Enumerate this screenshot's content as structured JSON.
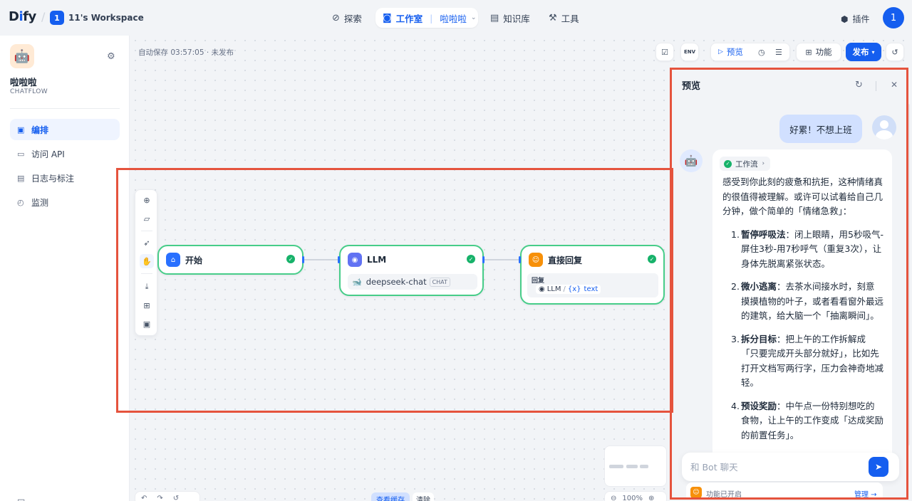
{
  "topbar": {
    "logo": "Dify",
    "workspace_badge": "1",
    "workspace_name": "11's Workspace",
    "nav": {
      "explore": "探索",
      "studio": "工作室",
      "app": "啦啦啦",
      "knowledge": "知识库",
      "tools": "工具"
    },
    "plugins": "插件",
    "user_initial": "1"
  },
  "sidebar": {
    "app_name": "啦啦啦",
    "app_type": "CHATFLOW",
    "items": [
      {
        "label": "编排",
        "active": true
      },
      {
        "label": "访问 API",
        "active": false
      },
      {
        "label": "日志与标注",
        "active": false
      },
      {
        "label": "监测",
        "active": false
      }
    ]
  },
  "canvas": {
    "autosave": "自动保存 03:57:05 · 未发布",
    "toolbar": {
      "env": "ENV",
      "preview": "预览",
      "features": "功能",
      "publish": "发布"
    },
    "nodes": {
      "start": {
        "title": "开始"
      },
      "llm": {
        "title": "LLM",
        "model": "deepseek-chat",
        "mode_badge": "CHAT"
      },
      "answer": {
        "title": "直接回复",
        "label": "回复",
        "var_node": "LLM",
        "var_name": "text",
        "var_prefix": "{x}"
      }
    },
    "bottom": {
      "view_cache": "查看缓存",
      "clear": "清除",
      "zoom": "100%"
    }
  },
  "preview": {
    "title": "预览",
    "user_message": "好累！不想上班",
    "workflow_chip": "工作流",
    "bot_intro": "感受到你此刻的疲惫和抗拒，这种情绪真的很值得被理解。或许可以试着给自己几分钟，做个简单的「情绪急救」：",
    "bot_items": [
      {
        "num": "1.",
        "title": "暂停呼吸法",
        "text": "：闭上眼睛，用5秒吸气-屏住3秒-用7秒呼气（重复3次），让身体先脱离紧张状态。"
      },
      {
        "num": "2.",
        "title": "微小逃离",
        "text": "：去茶水间接水时，刻意摸摸植物的叶子，或者看看窗外最远的建筑，给大脑一个「抽离瞬间」。"
      },
      {
        "num": "3.",
        "title": "拆分目标",
        "text": "：把上午的工作拆解成「只要完成开头部分就好」，比如先打开文档写两行字，压力会神奇地减轻。"
      },
      {
        "num": "4.",
        "title": "预设奖励",
        "text": "：中午点一份特别想吃的食物，让上午的工作变成「达成奖励的前置任务」。"
      }
    ],
    "input_placeholder": "和 Bot 聊天",
    "features_label": "功能已开启",
    "features_manage": "管理 →"
  },
  "colors": {
    "primary": "#155eef",
    "success": "#17b26a",
    "annotation": "#e5533d",
    "node_border": "#47cd89"
  }
}
